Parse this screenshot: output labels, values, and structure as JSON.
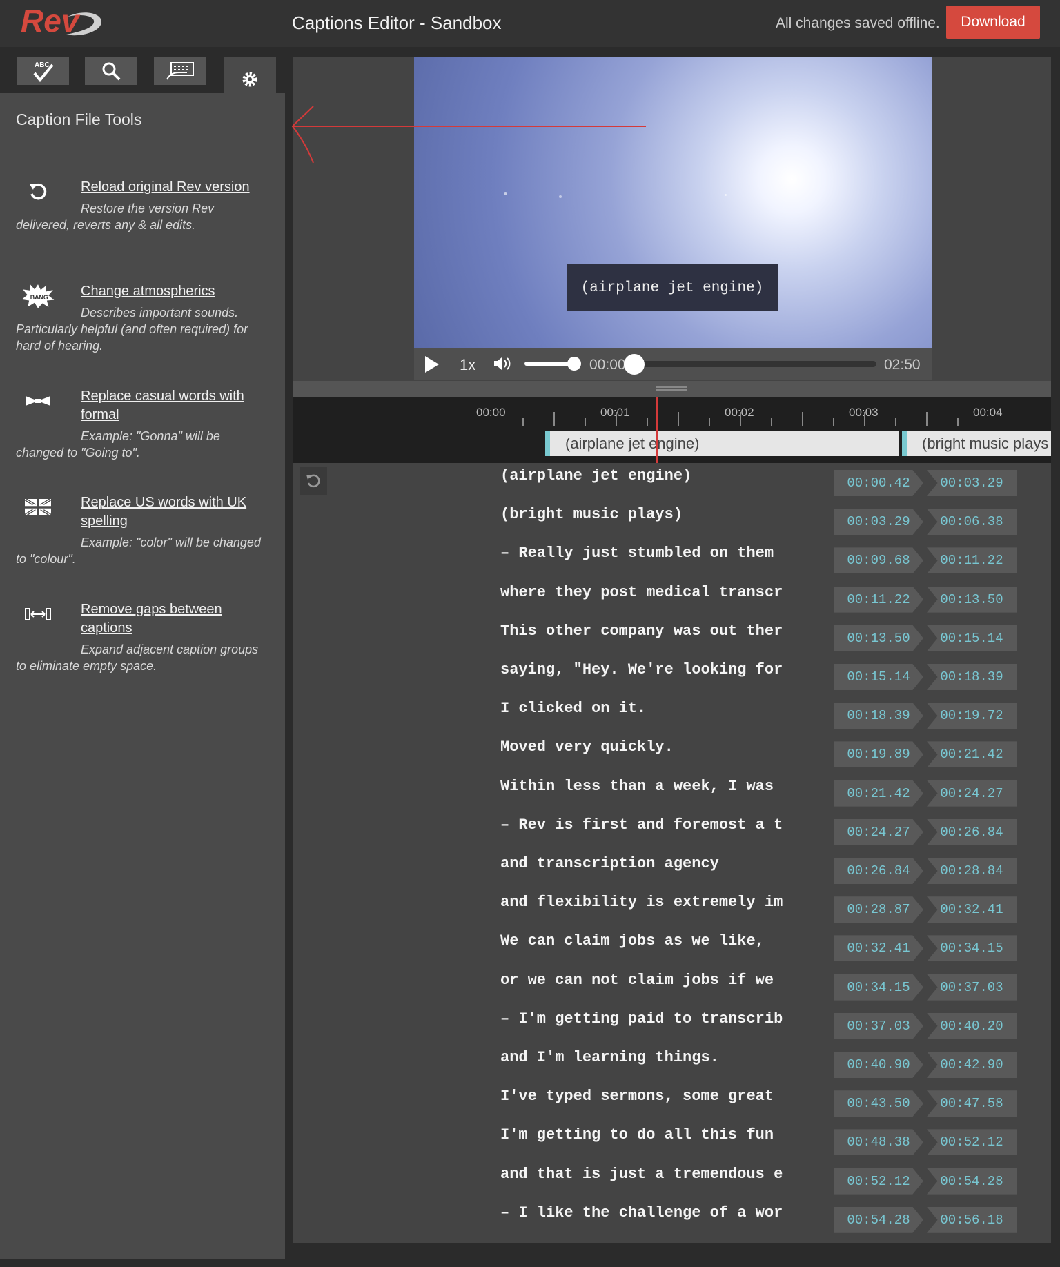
{
  "header": {
    "logo_text": "Rev",
    "title": "Captions Editor - Sandbox",
    "save_status": "All changes saved offline.",
    "download_label": "Download"
  },
  "toolbar": {
    "tabs": [
      {
        "icon": "spellcheck-icon",
        "label": "ABC"
      },
      {
        "icon": "search-icon"
      },
      {
        "icon": "keyboard-icon"
      },
      {
        "icon": "gear-icon",
        "active": true
      }
    ]
  },
  "sidebar": {
    "title": "Caption File Tools",
    "tools": [
      {
        "icon": "reload-icon",
        "label": "Reload original Rev version",
        "description": "Restore the version Rev delivered, reverts any & all edits."
      },
      {
        "icon": "bang-icon",
        "icon_text": "BANG",
        "label": "Change atmospherics",
        "description": "Describes important sounds. Particularly helpful (and often required) for hard of hearing."
      },
      {
        "icon": "bowtie-icon",
        "label": "Replace casual words with formal",
        "description": "Example: \"Gonna\" will be changed to \"Going to\"."
      },
      {
        "icon": "uk-flag-icon",
        "label": "Replace US words with UK spelling",
        "description": "Example: \"color\" will be changed to \"colour\"."
      },
      {
        "icon": "remove-gaps-icon",
        "label": "Remove gaps between captions",
        "description": "Expand adjacent caption groups to eliminate empty space."
      }
    ]
  },
  "player": {
    "caption_overlay": "(airplane jet engine)",
    "speed": "1x",
    "current_time": "00:00",
    "duration": "02:50",
    "volume_level": 0.9,
    "progress": 0.0
  },
  "timeline": {
    "ruler_labels": [
      "00:00",
      "00:01",
      "00:02",
      "00:03",
      "00:04"
    ],
    "blocks": [
      {
        "text": "(airplane jet engine)"
      },
      {
        "text": "(bright music plays"
      }
    ]
  },
  "captions": [
    {
      "text": "(airplane jet engine)",
      "start": "00:00.42",
      "end": "00:03.29"
    },
    {
      "text": "(bright music plays)",
      "start": "00:03.29",
      "end": "00:06.38"
    },
    {
      "text": "– Really just stumbled on them through",
      "start": "00:09.68",
      "end": "00:11.22"
    },
    {
      "text": "where they post medical transcription j",
      "start": "00:11.22",
      "end": "00:13.50"
    },
    {
      "text": "This other company was out there,",
      "start": "00:13.50",
      "end": "00:15.14"
    },
    {
      "text": "saying, \"Hey. We're looking for transc",
      "start": "00:15.14",
      "end": "00:18.39"
    },
    {
      "text": "I clicked on it.",
      "start": "00:18.39",
      "end": "00:19.72"
    },
    {
      "text": "Moved very quickly.",
      "start": "00:19.89",
      "end": "00:21.42"
    },
    {
      "text": "Within less than a week, I was already",
      "start": "00:21.42",
      "end": "00:24.27"
    },
    {
      "text": "– Rev is first and foremost a translati",
      "start": "00:24.27",
      "end": "00:26.84"
    },
    {
      "text": "and transcription agency",
      "start": "00:26.84",
      "end": "00:28.84"
    },
    {
      "text": "and flexibility is extremely important",
      "start": "00:28.87",
      "end": "00:32.41"
    },
    {
      "text": "We can claim jobs as we like,",
      "start": "00:32.41",
      "end": "00:34.15"
    },
    {
      "text": "or we can not claim jobs if we don't ha",
      "start": "00:34.15",
      "end": "00:37.03"
    },
    {
      "text": "– I'm getting paid to transcribe these",
      "start": "00:37.03",
      "end": "00:40.20"
    },
    {
      "text": "and I'm learning things.",
      "start": "00:40.90",
      "end": "00:42.90"
    },
    {
      "text": "I've typed sermons, some great inspiri",
      "start": "00:43.50",
      "end": "00:47.58"
    },
    {
      "text": "I'm getting to do all this fun stuff an",
      "start": "00:48.38",
      "end": "00:52.12"
    },
    {
      "text": "and that is just a tremendous experien",
      "start": "00:52.12",
      "end": "00:54.28"
    },
    {
      "text": "– I like the challenge of a word",
      "start": "00:54.28",
      "end": "00:56.18"
    }
  ]
}
